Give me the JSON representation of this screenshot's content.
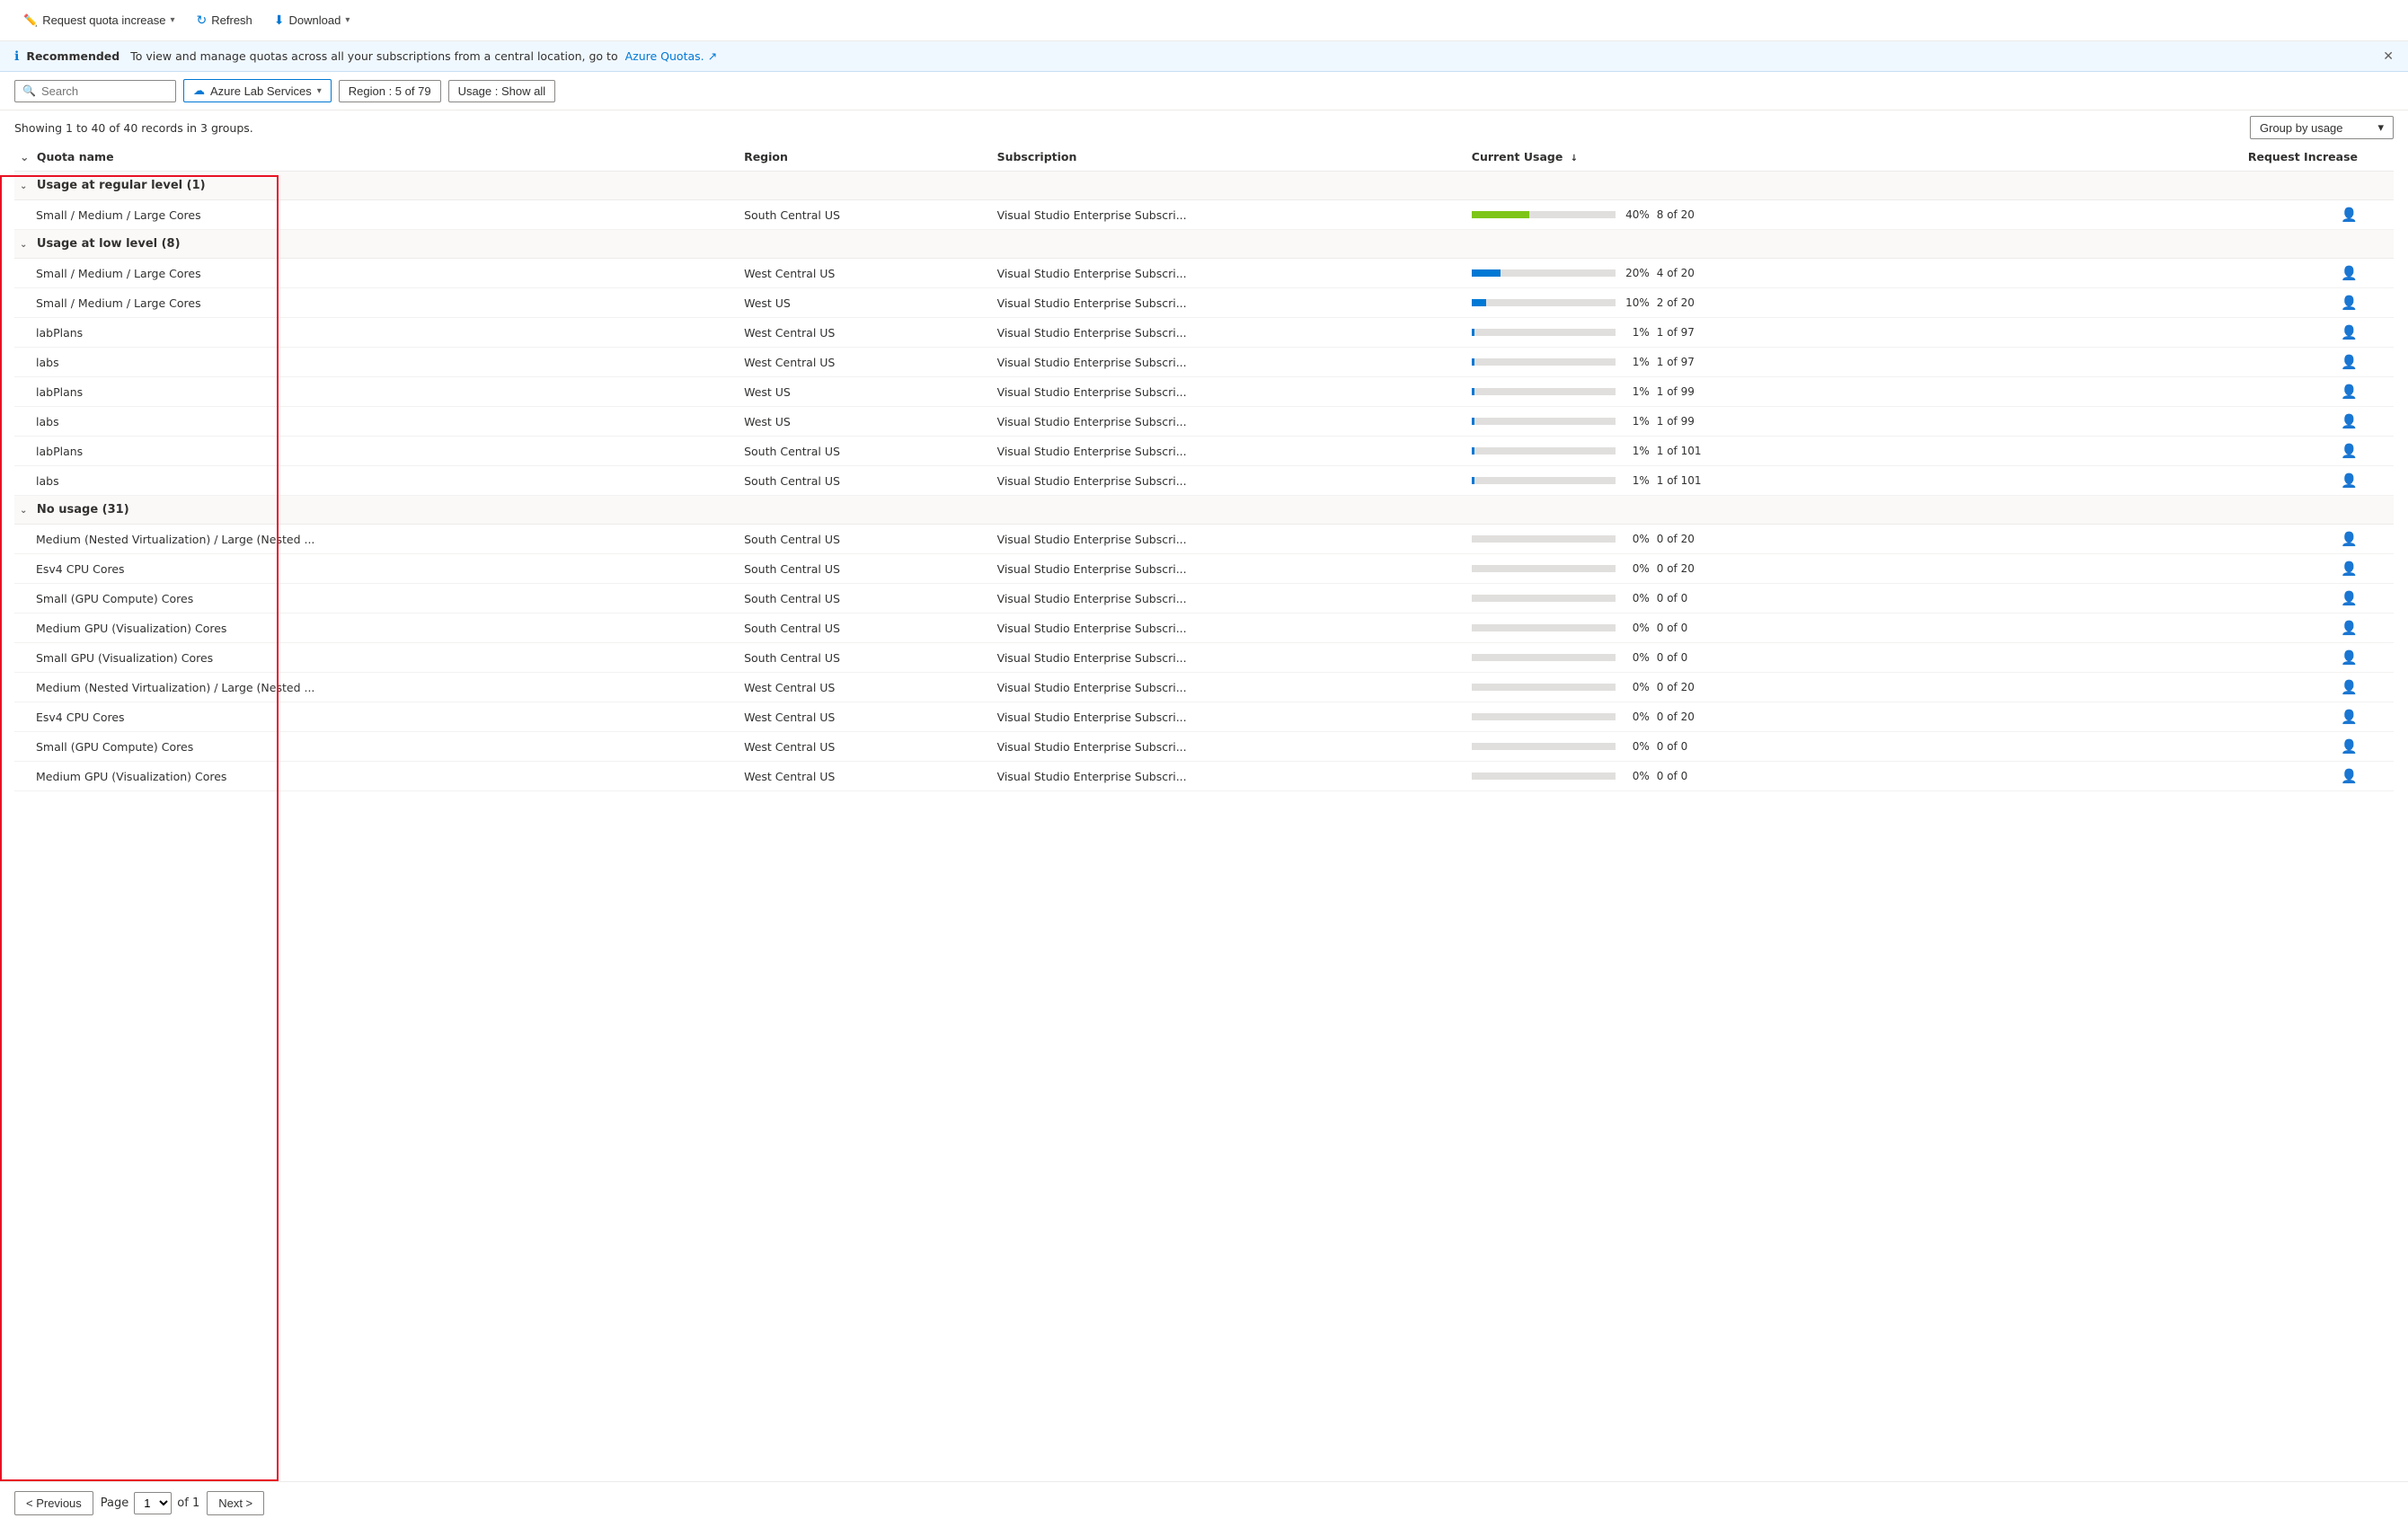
{
  "toolbar": {
    "request_quota_label": "Request quota increase",
    "refresh_label": "Refresh",
    "download_label": "Download"
  },
  "banner": {
    "recommended_label": "Recommended",
    "message": "To view and manage quotas across all your subscriptions from a central location, go to",
    "link_text": "Azure Quotas.",
    "link_icon": "↗"
  },
  "filters": {
    "search_placeholder": "Search",
    "service_filter": "Azure Lab Services",
    "region_filter": "Region : 5 of 79",
    "usage_filter": "Usage : Show all"
  },
  "records": {
    "info": "Showing 1 to 40 of 40 records in 3 groups.",
    "group_by_label": "Group by usage"
  },
  "table": {
    "headers": {
      "quota_name": "Quota name",
      "region": "Region",
      "subscription": "Subscription",
      "current_usage": "Current Usage",
      "request_increase": "Request Increase"
    },
    "groups": [
      {
        "id": "regular",
        "label": "Usage at regular level (1)",
        "rows": [
          {
            "quota_name": "Small / Medium / Large Cores",
            "region": "South Central US",
            "subscription": "Visual Studio Enterprise Subscri...",
            "usage_pct": 40,
            "usage_pct_label": "40%",
            "usage_count": "8 of 20",
            "bar_color": "#7dc518"
          }
        ]
      },
      {
        "id": "low",
        "label": "Usage at low level (8)",
        "rows": [
          {
            "quota_name": "Small / Medium / Large Cores",
            "region": "West Central US",
            "subscription": "Visual Studio Enterprise Subscri...",
            "usage_pct": 20,
            "usage_pct_label": "20%",
            "usage_count": "4 of 20",
            "bar_color": "#0078d4"
          },
          {
            "quota_name": "Small / Medium / Large Cores",
            "region": "West US",
            "subscription": "Visual Studio Enterprise Subscri...",
            "usage_pct": 10,
            "usage_pct_label": "10%",
            "usage_count": "2 of 20",
            "bar_color": "#0078d4"
          },
          {
            "quota_name": "labPlans",
            "region": "West Central US",
            "subscription": "Visual Studio Enterprise Subscri...",
            "usage_pct": 1,
            "usage_pct_label": "1%",
            "usage_count": "1 of 97",
            "bar_color": "#0078d4"
          },
          {
            "quota_name": "labs",
            "region": "West Central US",
            "subscription": "Visual Studio Enterprise Subscri...",
            "usage_pct": 1,
            "usage_pct_label": "1%",
            "usage_count": "1 of 97",
            "bar_color": "#0078d4"
          },
          {
            "quota_name": "labPlans",
            "region": "West US",
            "subscription": "Visual Studio Enterprise Subscri...",
            "usage_pct": 1,
            "usage_pct_label": "1%",
            "usage_count": "1 of 99",
            "bar_color": "#0078d4"
          },
          {
            "quota_name": "labs",
            "region": "West US",
            "subscription": "Visual Studio Enterprise Subscri...",
            "usage_pct": 1,
            "usage_pct_label": "1%",
            "usage_count": "1 of 99",
            "bar_color": "#0078d4"
          },
          {
            "quota_name": "labPlans",
            "region": "South Central US",
            "subscription": "Visual Studio Enterprise Subscri...",
            "usage_pct": 1,
            "usage_pct_label": "1%",
            "usage_count": "1 of 101",
            "bar_color": "#0078d4"
          },
          {
            "quota_name": "labs",
            "region": "South Central US",
            "subscription": "Visual Studio Enterprise Subscri...",
            "usage_pct": 1,
            "usage_pct_label": "1%",
            "usage_count": "1 of 101",
            "bar_color": "#0078d4"
          }
        ]
      },
      {
        "id": "no_usage",
        "label": "No usage (31)",
        "rows": [
          {
            "quota_name": "Medium (Nested Virtualization) / Large (Nested ...",
            "region": "South Central US",
            "subscription": "Visual Studio Enterprise Subscri...",
            "usage_pct": 0,
            "usage_pct_label": "0%",
            "usage_count": "0 of 20",
            "bar_color": "#c8c6c4"
          },
          {
            "quota_name": "Esv4 CPU Cores",
            "region": "South Central US",
            "subscription": "Visual Studio Enterprise Subscri...",
            "usage_pct": 0,
            "usage_pct_label": "0%",
            "usage_count": "0 of 20",
            "bar_color": "#c8c6c4"
          },
          {
            "quota_name": "Small (GPU Compute) Cores",
            "region": "South Central US",
            "subscription": "Visual Studio Enterprise Subscri...",
            "usage_pct": 0,
            "usage_pct_label": "0%",
            "usage_count": "0 of 0",
            "bar_color": "#c8c6c4"
          },
          {
            "quota_name": "Medium GPU (Visualization) Cores",
            "region": "South Central US",
            "subscription": "Visual Studio Enterprise Subscri...",
            "usage_pct": 0,
            "usage_pct_label": "0%",
            "usage_count": "0 of 0",
            "bar_color": "#c8c6c4"
          },
          {
            "quota_name": "Small GPU (Visualization) Cores",
            "region": "South Central US",
            "subscription": "Visual Studio Enterprise Subscri...",
            "usage_pct": 0,
            "usage_pct_label": "0%",
            "usage_count": "0 of 0",
            "bar_color": "#c8c6c4"
          },
          {
            "quota_name": "Medium (Nested Virtualization) / Large (Nested ...",
            "region": "West Central US",
            "subscription": "Visual Studio Enterprise Subscri...",
            "usage_pct": 0,
            "usage_pct_label": "0%",
            "usage_count": "0 of 20",
            "bar_color": "#c8c6c4"
          },
          {
            "quota_name": "Esv4 CPU Cores",
            "region": "West Central US",
            "subscription": "Visual Studio Enterprise Subscri...",
            "usage_pct": 0,
            "usage_pct_label": "0%",
            "usage_count": "0 of 20",
            "bar_color": "#c8c6c4"
          },
          {
            "quota_name": "Small (GPU Compute) Cores",
            "region": "West Central US",
            "subscription": "Visual Studio Enterprise Subscri...",
            "usage_pct": 0,
            "usage_pct_label": "0%",
            "usage_count": "0 of 0",
            "bar_color": "#c8c6c4"
          },
          {
            "quota_name": "Medium GPU (Visualization) Cores",
            "region": "West Central US",
            "subscription": "Visual Studio Enterprise Subscri...",
            "usage_pct": 0,
            "usage_pct_label": "0%",
            "usage_count": "0 of 0",
            "bar_color": "#c8c6c4"
          }
        ]
      }
    ]
  },
  "pagination": {
    "previous_label": "< Previous",
    "next_label": "Next >",
    "page_label": "Page",
    "current_page": "1",
    "of_label": "of 1"
  },
  "colors": {
    "accent": "#0078d4",
    "border_red": "#e81123",
    "bar_green": "#7dc518",
    "bar_blue": "#0078d4",
    "bar_empty": "#e1dfdd"
  }
}
